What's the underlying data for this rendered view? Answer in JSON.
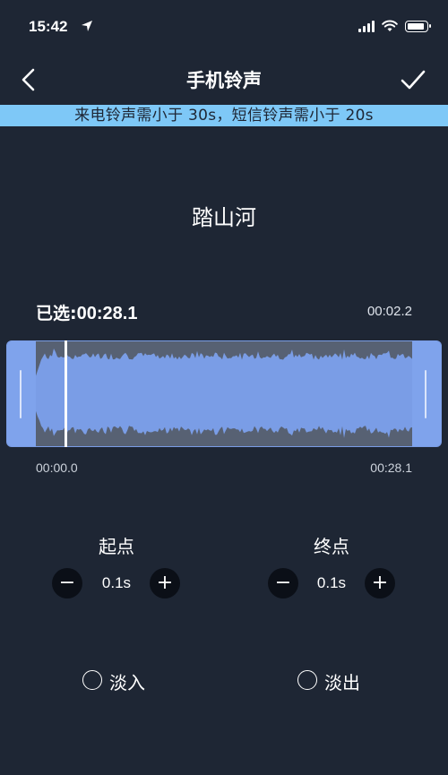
{
  "status": {
    "time": "15:42"
  },
  "nav": {
    "title": "手机铃声"
  },
  "banner": {
    "text": "来电铃声需小于 30s，短信铃声需小于 20s"
  },
  "song": {
    "title": "踏山河"
  },
  "selection": {
    "label": "已选:",
    "value": "00:28.1",
    "duration": "00:02.2"
  },
  "timeline": {
    "start": "00:00.0",
    "end": "00:28.1"
  },
  "start_point": {
    "label": "起点",
    "value": "0.1s",
    "minus": "−",
    "plus": "+"
  },
  "end_point": {
    "label": "终点",
    "value": "0.1s",
    "minus": "−",
    "plus": "+"
  },
  "options": {
    "fade_in": "淡入",
    "fade_out": "淡出"
  },
  "colors": {
    "background": "#1e2634",
    "banner": "#7ec8f7",
    "selection": "#7a9de6",
    "waveform": "#576173"
  }
}
